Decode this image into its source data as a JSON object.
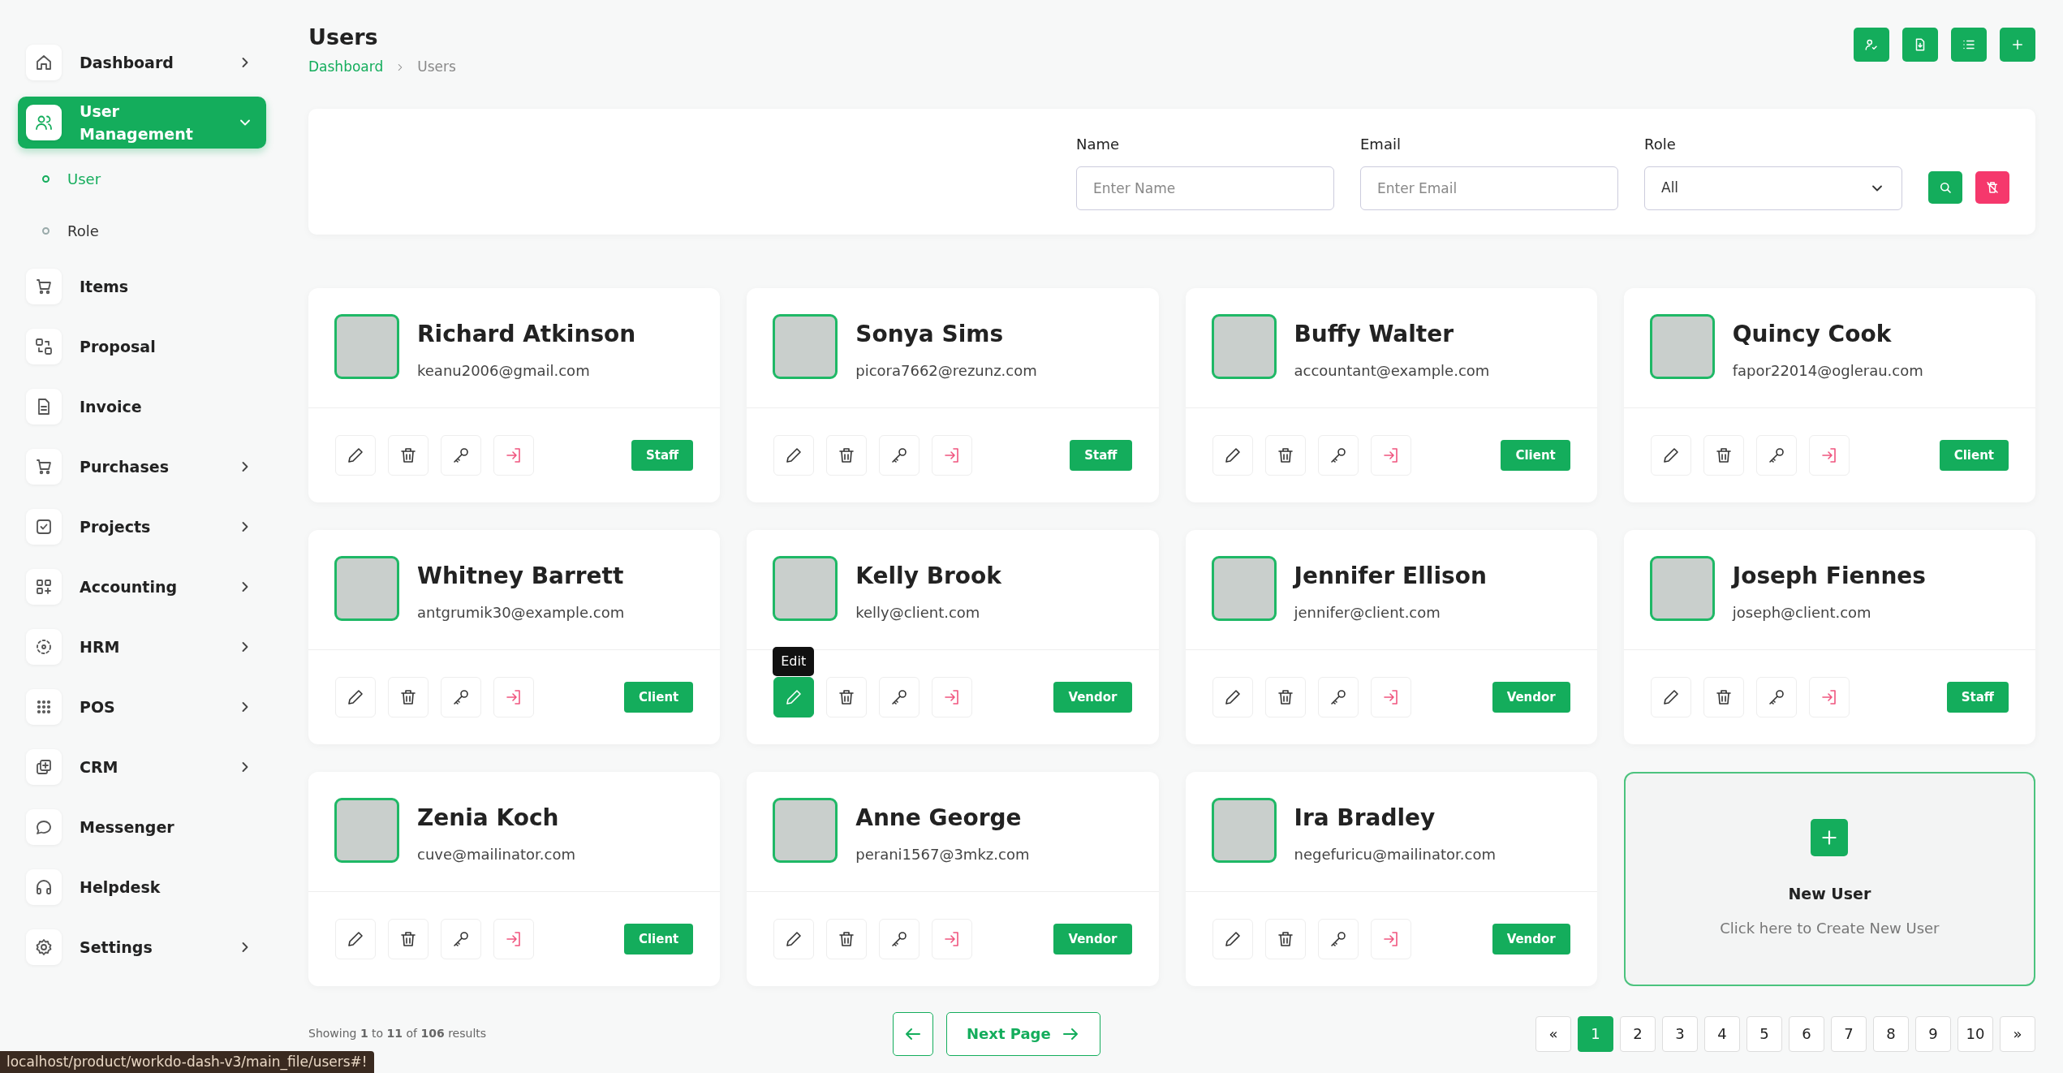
{
  "sidebar": {
    "items": [
      {
        "label": "Dashboard",
        "selected": false,
        "expanded": false
      },
      {
        "label": "User Management",
        "selected": true,
        "expanded": true,
        "children": [
          {
            "label": "User",
            "selected": true
          },
          {
            "label": "Role",
            "selected": false
          }
        ]
      },
      {
        "label": "Items",
        "selected": false
      },
      {
        "label": "Proposal",
        "selected": false
      },
      {
        "label": "Invoice",
        "selected": false
      },
      {
        "label": "Purchases",
        "selected": false,
        "expanded": false
      },
      {
        "label": "Projects",
        "selected": false,
        "expanded": false
      },
      {
        "label": "Accounting",
        "selected": false,
        "expanded": false
      },
      {
        "label": "HRM",
        "selected": false,
        "expanded": false
      },
      {
        "label": "POS",
        "selected": false,
        "expanded": false
      },
      {
        "label": "CRM",
        "selected": false,
        "expanded": false
      },
      {
        "label": "Messenger",
        "selected": false
      },
      {
        "label": "Helpdesk",
        "selected": false
      },
      {
        "label": "Settings",
        "selected": false,
        "expanded": false
      }
    ]
  },
  "page": {
    "title": "Users",
    "breadcrumb": [
      "Dashboard",
      "Users"
    ]
  },
  "filter": {
    "fields": [
      {
        "label": "Name",
        "kind": "text",
        "placeholder": "Enter Name"
      },
      {
        "label": "Email",
        "kind": "text",
        "placeholder": "Enter Email"
      },
      {
        "label": "Role",
        "kind": "select",
        "value": "All"
      }
    ]
  },
  "users": [
    {
      "name": "Richard Atkinson",
      "email": "keanu2006@gmail.com",
      "role": "Staff",
      "edit_hovered": false
    },
    {
      "name": "Sonya Sims",
      "email": "picora7662@rezunz.com",
      "role": "Staff",
      "edit_hovered": false
    },
    {
      "name": "Buffy Walter",
      "email": "accountant@example.com",
      "role": "Client",
      "edit_hovered": false
    },
    {
      "name": "Quincy Cook",
      "email": "fapor22014@oglerau.com",
      "role": "Client",
      "edit_hovered": false
    },
    {
      "name": "Whitney Barrett",
      "email": "antgrumik30@example.com",
      "role": "Client",
      "edit_hovered": false
    },
    {
      "name": "Kelly Brook",
      "email": "kelly@client.com",
      "role": "Vendor",
      "edit_hovered": true,
      "tooltip": "Edit"
    },
    {
      "name": "Jennifer Ellison",
      "email": "jennifer@client.com",
      "role": "Vendor",
      "edit_hovered": false
    },
    {
      "name": "Joseph Fiennes",
      "email": "joseph@client.com",
      "role": "Staff",
      "edit_hovered": false
    },
    {
      "name": "Zenia Koch",
      "email": "cuve@mailinator.com",
      "role": "Client",
      "edit_hovered": false
    },
    {
      "name": "Anne George",
      "email": "perani1567@3mkz.com",
      "role": "Vendor",
      "edit_hovered": false
    },
    {
      "name": "Ira Bradley",
      "email": "negefuricu@mailinator.com",
      "role": "Vendor",
      "edit_hovered": false
    }
  ],
  "new_user": {
    "title": "New User",
    "subtitle": "Click here to Create New User"
  },
  "footer": {
    "summary": "Showing **1** to **11** of **106** results",
    "next_label": "Next Page",
    "pages": [
      {
        "label": "«",
        "selected": false
      },
      {
        "label": "1",
        "selected": true
      },
      {
        "label": "2",
        "selected": false
      },
      {
        "label": "3",
        "selected": false
      },
      {
        "label": "4",
        "selected": false
      },
      {
        "label": "5",
        "selected": false
      },
      {
        "label": "6",
        "selected": false
      },
      {
        "label": "7",
        "selected": false
      },
      {
        "label": "8",
        "selected": false
      },
      {
        "label": "9",
        "selected": false
      },
      {
        "label": "10",
        "selected": false
      },
      {
        "label": "»",
        "selected": false
      }
    ]
  },
  "status_bar": {
    "url": "localhost/product/workdo-dash-v3/main_file/users#!"
  }
}
